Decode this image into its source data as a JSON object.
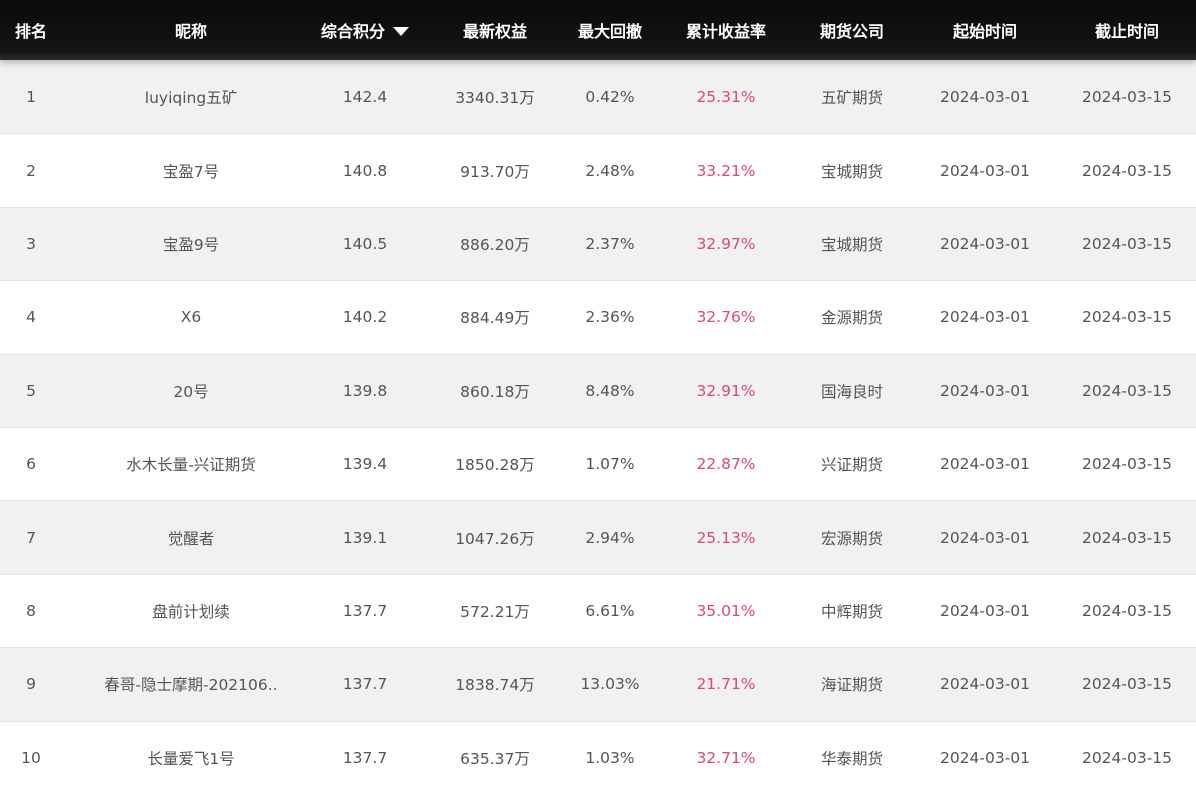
{
  "headers": {
    "rank": "排名",
    "nickname": "昵称",
    "score": "综合积分",
    "equity": "最新权益",
    "drawdown": "最大回撤",
    "return_rate": "累计收益率",
    "company": "期货公司",
    "start": "起始时间",
    "end": "截止时间",
    "sort_icon": "chevron-down-icon"
  },
  "colors": {
    "header_bg": "#111111",
    "header_text": "#ffffff",
    "row_text": "#555555",
    "rate_text": "#e0457b",
    "odd_row_bg": "#f1f1f1"
  },
  "rows": [
    {
      "rank": "1",
      "nickname": "luyiqing五矿",
      "score": "142.4",
      "equity": "3340.31万",
      "drawdown": "0.42%",
      "return_rate": "25.31%",
      "company": "五矿期货",
      "start": "2024-03-01",
      "end": "2024-03-15"
    },
    {
      "rank": "2",
      "nickname": "宝盈7号",
      "score": "140.8",
      "equity": "913.70万",
      "drawdown": "2.48%",
      "return_rate": "33.21%",
      "company": "宝城期货",
      "start": "2024-03-01",
      "end": "2024-03-15"
    },
    {
      "rank": "3",
      "nickname": "宝盈9号",
      "score": "140.5",
      "equity": "886.20万",
      "drawdown": "2.37%",
      "return_rate": "32.97%",
      "company": "宝城期货",
      "start": "2024-03-01",
      "end": "2024-03-15"
    },
    {
      "rank": "4",
      "nickname": "X6",
      "score": "140.2",
      "equity": "884.49万",
      "drawdown": "2.36%",
      "return_rate": "32.76%",
      "company": "金源期货",
      "start": "2024-03-01",
      "end": "2024-03-15"
    },
    {
      "rank": "5",
      "nickname": "20号",
      "score": "139.8",
      "equity": "860.18万",
      "drawdown": "8.48%",
      "return_rate": "32.91%",
      "company": "国海良时",
      "start": "2024-03-01",
      "end": "2024-03-15"
    },
    {
      "rank": "6",
      "nickname": "水木长量-兴证期货",
      "score": "139.4",
      "equity": "1850.28万",
      "drawdown": "1.07%",
      "return_rate": "22.87%",
      "company": "兴证期货",
      "start": "2024-03-01",
      "end": "2024-03-15"
    },
    {
      "rank": "7",
      "nickname": "觉醒者",
      "score": "139.1",
      "equity": "1047.26万",
      "drawdown": "2.94%",
      "return_rate": "25.13%",
      "company": "宏源期货",
      "start": "2024-03-01",
      "end": "2024-03-15"
    },
    {
      "rank": "8",
      "nickname": "盘前计划续",
      "score": "137.7",
      "equity": "572.21万",
      "drawdown": "6.61%",
      "return_rate": "35.01%",
      "company": "中辉期货",
      "start": "2024-03-01",
      "end": "2024-03-15"
    },
    {
      "rank": "9",
      "nickname": "春哥-隐士摩期-202106..",
      "score": "137.7",
      "equity": "1838.74万",
      "drawdown": "13.03%",
      "return_rate": "21.71%",
      "company": "海证期货",
      "start": "2024-03-01",
      "end": "2024-03-15"
    },
    {
      "rank": "10",
      "nickname": "长量爱飞1号",
      "score": "137.7",
      "equity": "635.37万",
      "drawdown": "1.03%",
      "return_rate": "32.71%",
      "company": "华泰期货",
      "start": "2024-03-01",
      "end": "2024-03-15"
    }
  ]
}
